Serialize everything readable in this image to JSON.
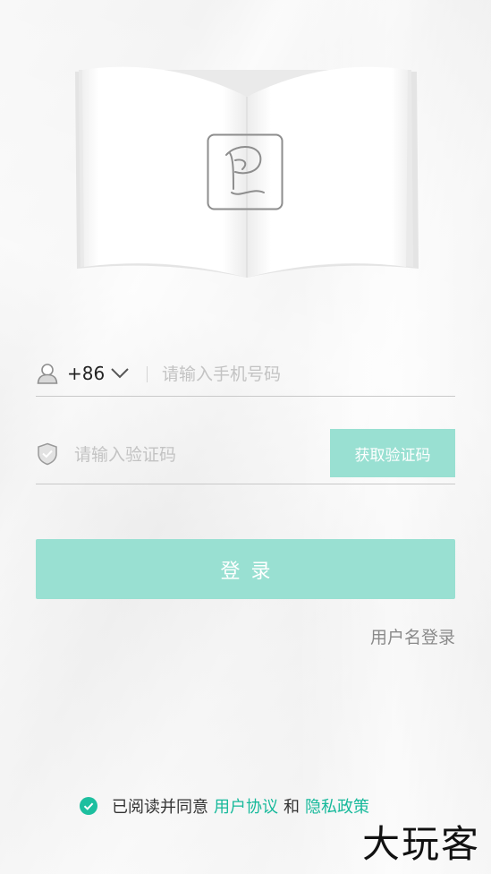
{
  "login": {
    "country_code": "+86",
    "phone_placeholder": "请输入手机号码",
    "code_placeholder": "请输入验证码",
    "get_code_label": "获取验证码",
    "login_label": "登录",
    "username_login_label": "用户名登录"
  },
  "agreement": {
    "prefix": "已阅读并同意",
    "user_agreement": "用户协议",
    "conjunction": "和",
    "privacy_policy": "隐私政策"
  },
  "watermark": "大玩客",
  "icons": {
    "logo": "p-logo-icon",
    "user": "user-icon",
    "dropdown": "chevron-down-icon",
    "security": "shield-icon",
    "agree": "check-circle-icon"
  },
  "colors": {
    "accent": "#99e0d2",
    "link": "#17b99b",
    "check": "#1dbf9f"
  }
}
